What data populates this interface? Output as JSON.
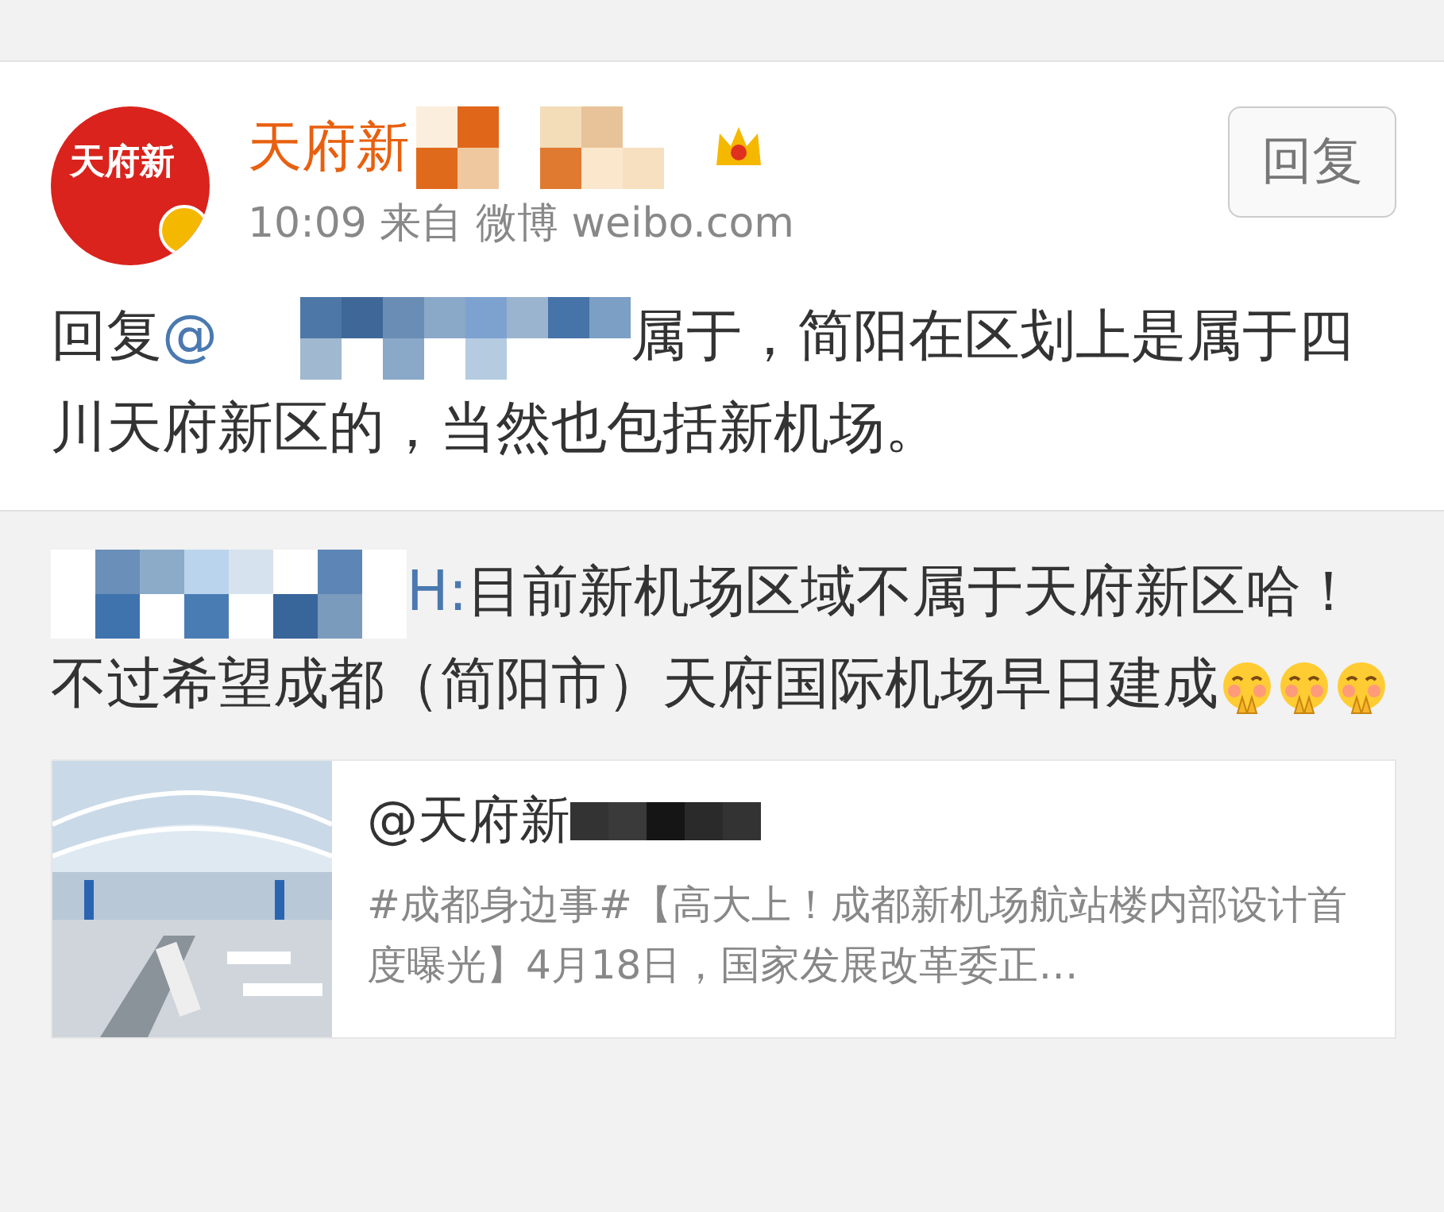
{
  "post": {
    "avatar_text": "天府新",
    "author": "天府新",
    "time": "10:09",
    "source": "来自 微博 weibo.com",
    "reply_button": "回复",
    "text_prefix": "回复@",
    "text_rest": "属于，简阳在区划上是属于四川天府新区的，当然也包括新机场。"
  },
  "quoted": {
    "mention_tail": "H:",
    "text": "目前新机场区域不属于天府新区哈！不过希望成都（简阳市）天府国际机场早日建成",
    "emojis": [
      {
        "kind": "face"
      },
      {
        "kind": "face"
      },
      {
        "kind": "face"
      }
    ],
    "link_card": {
      "title": "@天府新",
      "summary": "#成都身边事#【高大上！成都新机场航站楼内部设计首度曝光】4月18日，国家发展改革委正…"
    }
  }
}
